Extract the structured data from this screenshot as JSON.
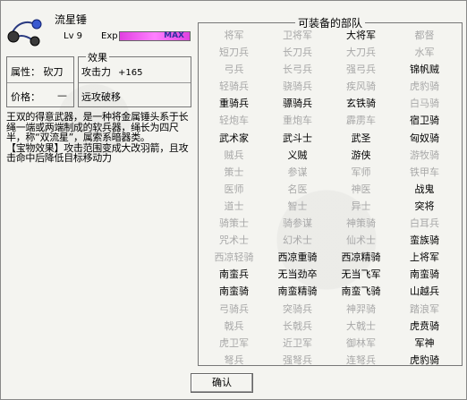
{
  "item": {
    "name": "流星锤",
    "level": "Lv 9",
    "exp_label": "Exp",
    "exp_status": "MAX",
    "exp_fill": 1.0,
    "icon": "meteor-hammer-icon"
  },
  "attributes": {
    "attr_text": "属性： 砍刀",
    "price_label": "价格：",
    "price_value": "—"
  },
  "effects": {
    "title": "效果",
    "attack_label": "攻击力",
    "attack_value": "+165",
    "special": "远攻破移"
  },
  "description": {
    "main": "王双的得意武器，是一种将金属锤头系于长绳一端或两端制成的软兵器，绳长为四尺半，称“双流星”，属索系暗器类。",
    "effect": "【宝物效果】攻击范围变成大改羽箭，且攻击命中后降低目标移动力"
  },
  "units_panel": {
    "title": "可装备的部队",
    "units": [
      {
        "name": "将军",
        "on": false
      },
      {
        "name": "卫将军",
        "on": false
      },
      {
        "name": "大将军",
        "on": true
      },
      {
        "name": "都督",
        "on": false
      },
      {
        "name": "短刀兵",
        "on": false
      },
      {
        "name": "长刀兵",
        "on": false
      },
      {
        "name": "大刀兵",
        "on": false
      },
      {
        "name": "水军",
        "on": false
      },
      {
        "name": "弓兵",
        "on": false
      },
      {
        "name": "长弓兵",
        "on": false
      },
      {
        "name": "强弓兵",
        "on": false
      },
      {
        "name": "锦帆贼",
        "on": true
      },
      {
        "name": "轻骑兵",
        "on": false
      },
      {
        "name": "骁骑兵",
        "on": false
      },
      {
        "name": "疾风骑",
        "on": false
      },
      {
        "name": "虎豹骑",
        "on": false
      },
      {
        "name": "重骑兵",
        "on": true
      },
      {
        "name": "骠骑兵",
        "on": true
      },
      {
        "name": "玄铁骑",
        "on": true
      },
      {
        "name": "白马骑",
        "on": false
      },
      {
        "name": "轻炮车",
        "on": false
      },
      {
        "name": "重炮车",
        "on": false
      },
      {
        "name": "霹雳车",
        "on": false
      },
      {
        "name": "宿卫骑",
        "on": true
      },
      {
        "name": "武术家",
        "on": true
      },
      {
        "name": "武斗士",
        "on": true
      },
      {
        "name": "武圣",
        "on": true
      },
      {
        "name": "匈奴骑",
        "on": true
      },
      {
        "name": "贼兵",
        "on": false
      },
      {
        "name": "义贼",
        "on": true
      },
      {
        "name": "游侠",
        "on": true
      },
      {
        "name": "游牧骑",
        "on": false
      },
      {
        "name": "策士",
        "on": false
      },
      {
        "name": "参谋",
        "on": false
      },
      {
        "name": "军师",
        "on": false
      },
      {
        "name": "铁甲车",
        "on": false
      },
      {
        "name": "医师",
        "on": false
      },
      {
        "name": "名医",
        "on": false
      },
      {
        "name": "神医",
        "on": false
      },
      {
        "name": "战鬼",
        "on": true
      },
      {
        "name": "道士",
        "on": false
      },
      {
        "name": "智士",
        "on": false
      },
      {
        "name": "异士",
        "on": false
      },
      {
        "name": "突将",
        "on": true
      },
      {
        "name": "骑策士",
        "on": false
      },
      {
        "name": "骑参谋",
        "on": false
      },
      {
        "name": "神策骑",
        "on": false
      },
      {
        "name": "白耳兵",
        "on": false
      },
      {
        "name": "咒术士",
        "on": false
      },
      {
        "name": "幻术士",
        "on": false
      },
      {
        "name": "仙术士",
        "on": false
      },
      {
        "name": "蛮族骑",
        "on": true
      },
      {
        "name": "西凉轻骑",
        "on": false
      },
      {
        "name": "西凉重骑",
        "on": true
      },
      {
        "name": "西凉精骑",
        "on": true
      },
      {
        "name": "上将军",
        "on": true
      },
      {
        "name": "南蛮兵",
        "on": true
      },
      {
        "name": "无当劲卒",
        "on": true
      },
      {
        "name": "无当飞军",
        "on": true
      },
      {
        "name": "南蛮骑",
        "on": true
      },
      {
        "name": "南蛮骑",
        "on": true
      },
      {
        "name": "南蛮精骑",
        "on": true
      },
      {
        "name": "南蛮飞骑",
        "on": true
      },
      {
        "name": "山越兵",
        "on": true
      },
      {
        "name": "弓骑兵",
        "on": false
      },
      {
        "name": "突骑兵",
        "on": false
      },
      {
        "name": "神羿骑",
        "on": false
      },
      {
        "name": "踏浪军",
        "on": false
      },
      {
        "name": "戟兵",
        "on": false
      },
      {
        "name": "长戟兵",
        "on": false
      },
      {
        "name": "大戟士",
        "on": false
      },
      {
        "name": "虎贲骑",
        "on": true
      },
      {
        "name": "虎卫军",
        "on": false
      },
      {
        "name": "近卫军",
        "on": false
      },
      {
        "name": "御林军",
        "on": false
      },
      {
        "name": "军神",
        "on": true
      },
      {
        "name": "弩兵",
        "on": false
      },
      {
        "name": "强弩兵",
        "on": false
      },
      {
        "name": "连弩兵",
        "on": false
      },
      {
        "name": "虎豹骑",
        "on": true
      }
    ]
  },
  "confirm_label": "确认",
  "colors": {
    "enabled": "#000000",
    "disabled": "#a8a8a8",
    "exp_bar": "#ff80ff"
  }
}
